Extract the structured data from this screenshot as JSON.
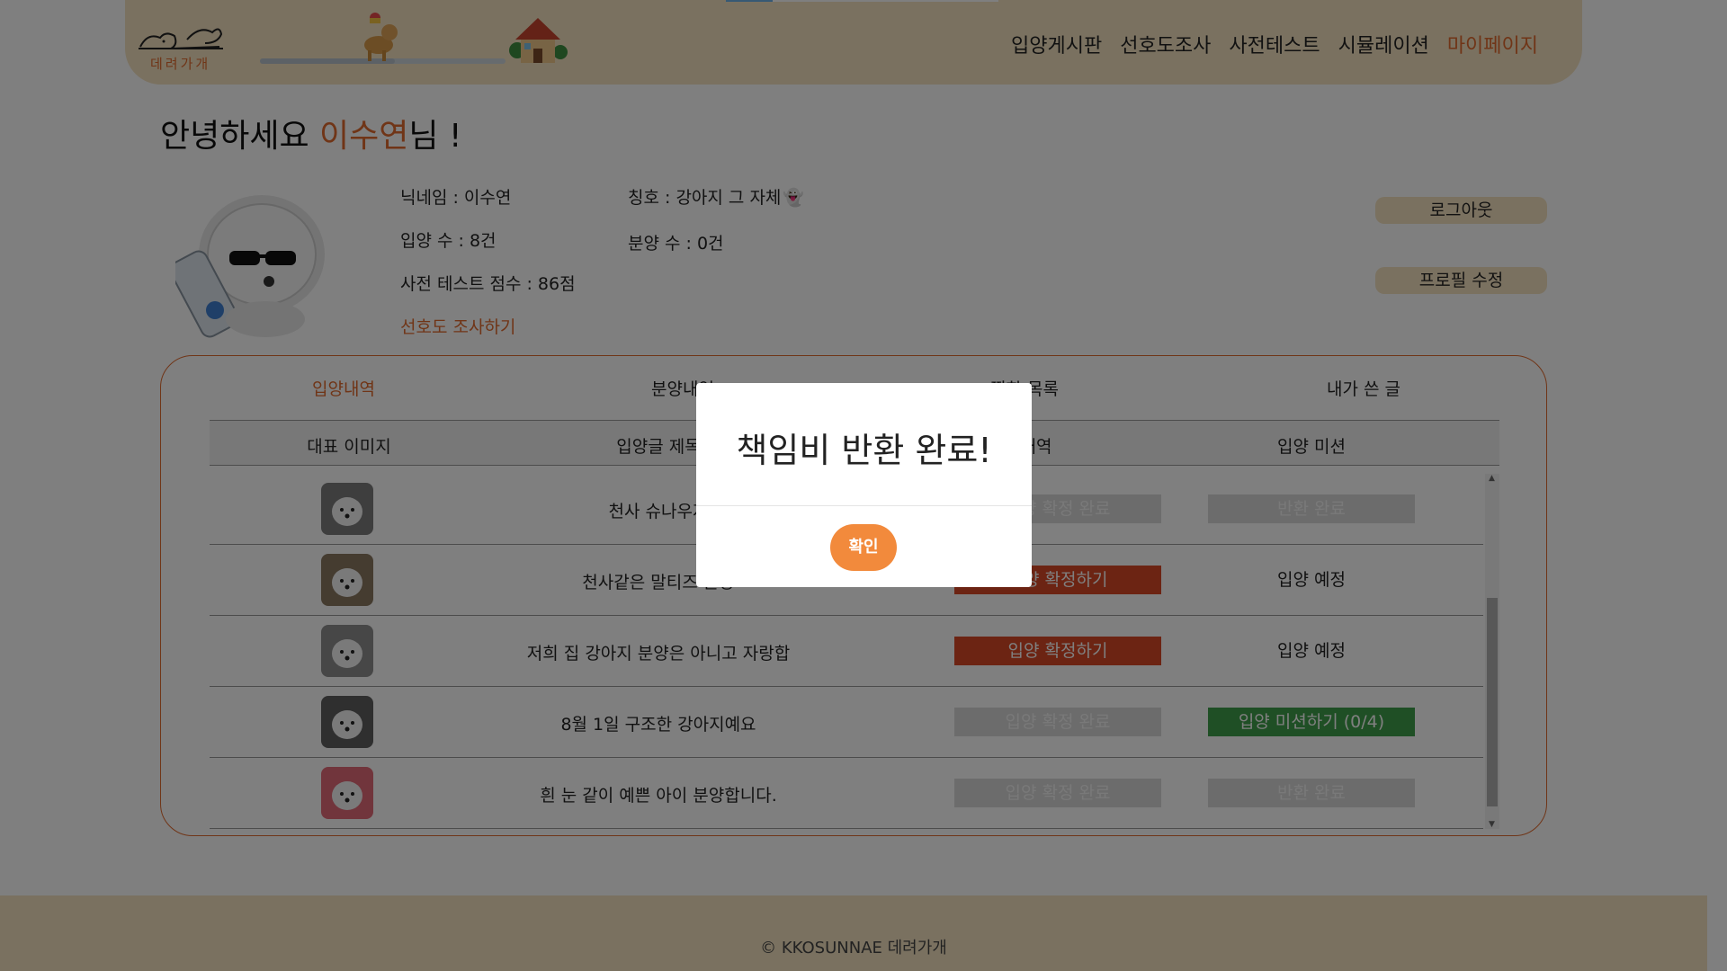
{
  "header": {
    "logo_text": "데려가개",
    "nav": [
      {
        "label": "입양게시판",
        "active": false
      },
      {
        "label": "선호도조사",
        "active": false
      },
      {
        "label": "사전테스트",
        "active": false
      },
      {
        "label": "시뮬레이션",
        "active": false
      },
      {
        "label": "마이페이지",
        "active": true
      }
    ],
    "top_progress": 0.17,
    "slider_progress": 0.55
  },
  "greeting": {
    "prefix": "안녕하세요 ",
    "name": "이수연",
    "suffix": "님 !"
  },
  "profile": {
    "nickname": "닉네임 : 이수연",
    "title": "칭호 : 강아지 그 자체",
    "adopt_count": "입양 수 : 8건",
    "give_count": "분양 수 : 0건",
    "test_score": "사전 테스트 점수 : 86점",
    "survey_link": "선호도 조사하기",
    "logout_label": "로그아웃",
    "edit_label": "프로필 수정"
  },
  "tabs": [
    {
      "label": "입양내역",
      "active": true
    },
    {
      "label": "분양내역",
      "active": false
    },
    {
      "label": "찜한 목록",
      "active": false
    },
    {
      "label": "내가 쓴 글",
      "active": false
    }
  ],
  "table": {
    "headers": [
      "대표 이미지",
      "입양글 제목",
      "입양 확정 내역",
      "입양 미션"
    ],
    "rows": [
      {
        "title": "천사 슈나우저",
        "confirm": {
          "label": "입양 확정 완료",
          "state": "done"
        },
        "mission": {
          "label": "반환 완료",
          "state": "done"
        },
        "thumb_bg": "#7d7d7d"
      },
      {
        "title": "천사같은 말티즈 분양",
        "confirm": {
          "label": "입양 확정하기",
          "state": "red"
        },
        "mission": {
          "label": "입양 예정",
          "state": "plain"
        },
        "thumb_bg": "#8a7860"
      },
      {
        "title": "저희 집 강아지 분양은 아니고 자랑합",
        "confirm": {
          "label": "입양 확정하기",
          "state": "red"
        },
        "mission": {
          "label": "입양 예정",
          "state": "plain"
        },
        "thumb_bg": "#8f8f8f"
      },
      {
        "title": "8월 1일 구조한 강아지예요",
        "confirm": {
          "label": "입양 확정 완료",
          "state": "done"
        },
        "mission": {
          "label": "입양 미션하기 (0/4)",
          "state": "green"
        },
        "thumb_bg": "#5e5e5e"
      },
      {
        "title": "흰 눈 같이 예쁜 아이 분양합니다.",
        "confirm": {
          "label": "입양 확정 완료",
          "state": "done"
        },
        "mission": {
          "label": "반환 완료",
          "state": "done"
        },
        "thumb_bg": "#e26a78"
      }
    ]
  },
  "footer": {
    "text": "© KKOSUNNAE 데려가개"
  },
  "modal": {
    "message": "책임비 반환 완료!",
    "confirm_label": "확인"
  },
  "colors": {
    "accent": "#e06a2e",
    "header_bg": "#f4e3c1",
    "red_btn": "#d94826",
    "green_btn": "#3f9e4a",
    "modal_btn": "#f28a3c"
  }
}
